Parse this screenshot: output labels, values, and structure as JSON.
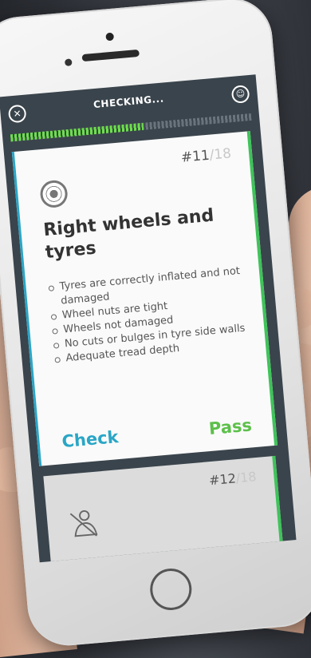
{
  "header": {
    "title": "CHECKING...",
    "close_icon": "close-icon",
    "profile_icon": "profile-icon"
  },
  "progress": {
    "completed": 10,
    "total": 18,
    "fraction": 0.55
  },
  "current_card": {
    "number": "#11",
    "total": "/18",
    "icon": "wheel-icon",
    "title": "Right wheels and tyres",
    "items": [
      "Tyres are correctly inflated and not damaged",
      "Wheel nuts are tight",
      "Wheels not damaged",
      "No cuts or bulges in tyre side walls",
      "Adequate tread depth"
    ],
    "check_label": "Check",
    "pass_label": "Pass"
  },
  "next_card": {
    "number": "#12",
    "total": "/18",
    "icon": "seatbelt-icon"
  },
  "colors": {
    "accent_blue": "#2aa6c6",
    "accent_green": "#5cc04a",
    "screen_bg": "#3a444c"
  }
}
